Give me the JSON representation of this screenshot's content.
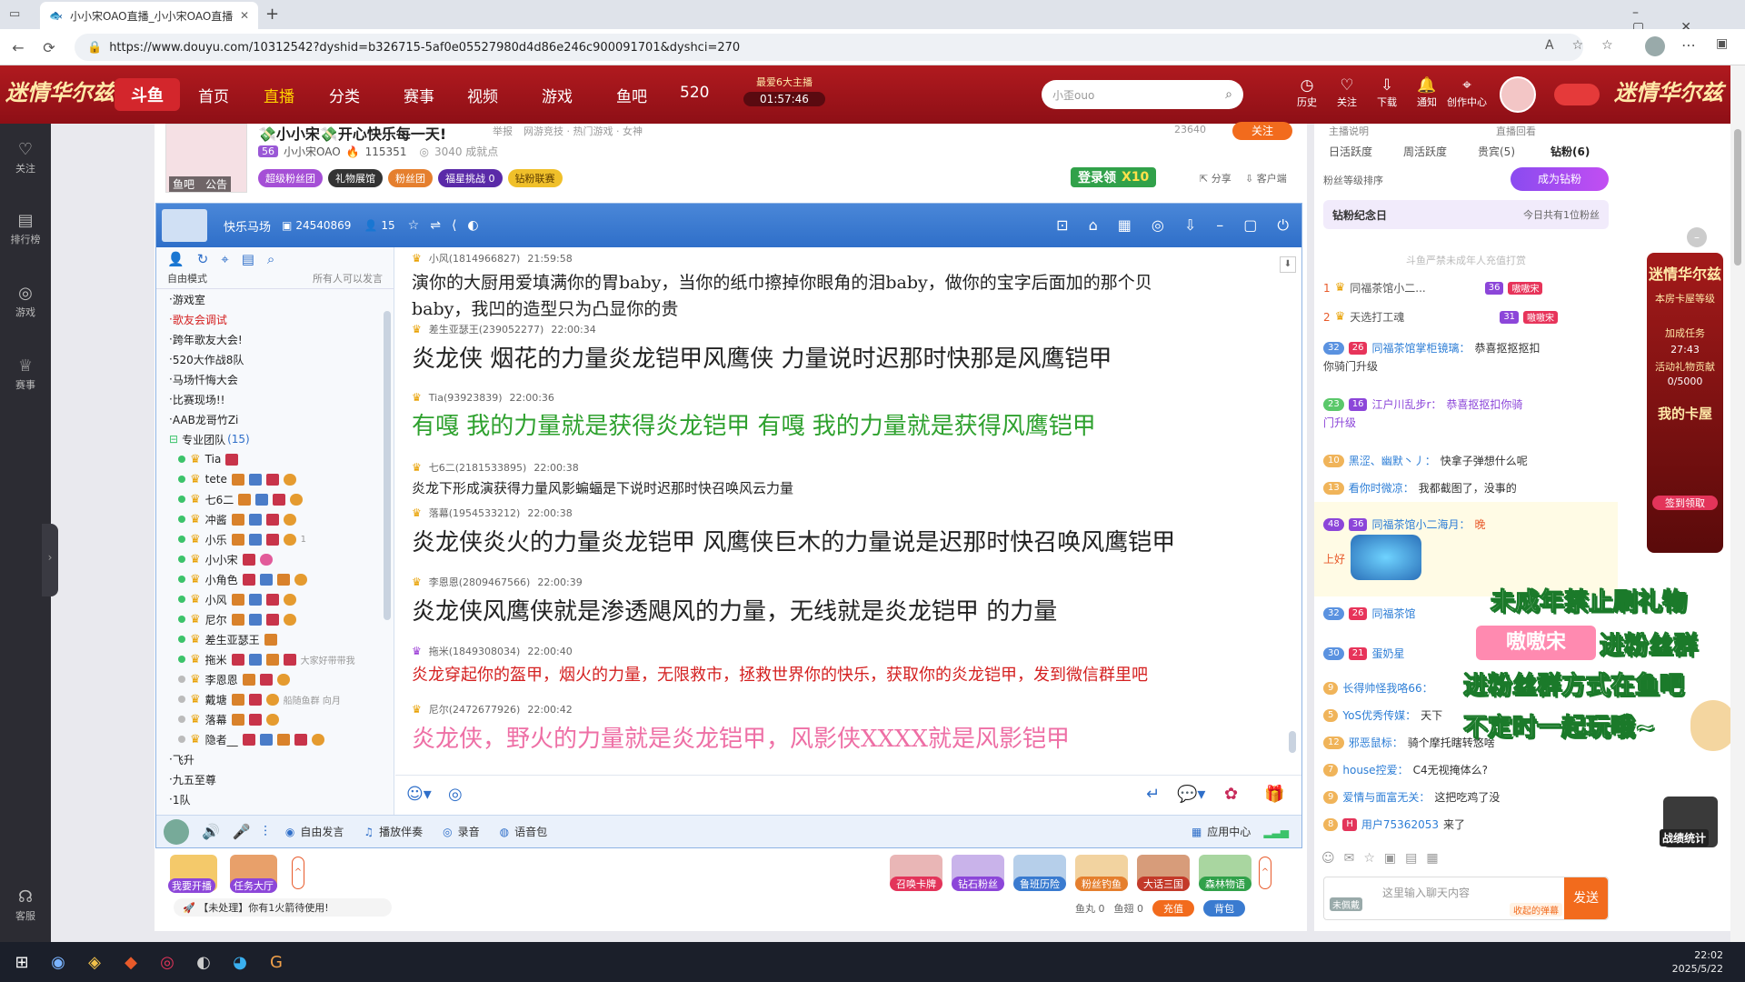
{
  "browser": {
    "tab_title": "小小宋OAO直播_小小宋OAO直播",
    "url": "https://www.douyu.com/10312542?dyshid=b326715-5af0e05527980d4d86e246c900091701&dyshci=270"
  },
  "header": {
    "nav": [
      "首页",
      "直播",
      "分类",
      "赛事",
      "视频",
      "游戏",
      "鱼吧",
      "520"
    ],
    "promo_title": "最爱6大主播",
    "promo_timer": "01:57:46",
    "search_placeholder": "小歪ouo",
    "icons": [
      {
        "label": "历史",
        "icon": "clock-icon"
      },
      {
        "label": "关注",
        "icon": "heart-icon"
      },
      {
        "label": "下载",
        "icon": "download-icon"
      },
      {
        "label": "通知",
        "icon": "bell-icon"
      },
      {
        "label": "创作中心",
        "icon": "pin-icon"
      }
    ],
    "banner_left": "迷情华尔兹",
    "banner_right": "迷情华尔兹"
  },
  "left_sidebar": [
    {
      "label": "关注",
      "icon": "heart-icon"
    },
    {
      "label": "排行榜",
      "icon": "chart-icon"
    },
    {
      "label": "游戏",
      "icon": "gamepad-icon"
    },
    {
      "label": "赛事",
      "icon": "trophy-icon"
    },
    {
      "label": "客服",
      "icon": "headset-icon"
    }
  ],
  "anchor": {
    "title": "💸小小宋💸开心快乐每一天!",
    "report": "举报",
    "category": "网游竞技 · 热门游戏 · 女神",
    "level": "56",
    "name": "小小宋OAO",
    "heat": "115351",
    "achievement": "3040 成就点",
    "follow_count": "23640",
    "follow_btn": "关注",
    "fishbar": "鱼吧",
    "announce": "公告",
    "tags": [
      "超级粉丝团",
      "礼物展馆",
      "粉丝团",
      "福星挑战",
      "钻粉联赛"
    ],
    "fuxing_count": "0",
    "login_reward": "登录领",
    "login_reward_count": "X10",
    "share": "分享",
    "client": "客户端"
  },
  "client": {
    "channel_name": "快乐马场",
    "channel_id": "24540869",
    "online": "15",
    "mode": "自由模式",
    "mode_note": "所有人可以发言",
    "tree_top": [
      "游戏室",
      "歌友会调试",
      "跨年歌友大会!",
      "520大作战8队",
      "马场忏悔大会",
      "比赛现场!!",
      "AAB龙哥竹Zi"
    ],
    "team_label": "专业团队",
    "team_count": "(15)",
    "members": [
      {
        "name": "Tia",
        "online": true
      },
      {
        "name": "tete",
        "online": true
      },
      {
        "name": "七6二",
        "online": true
      },
      {
        "name": "冲酱",
        "online": true
      },
      {
        "name": "小乐",
        "online": true,
        "extra": "1"
      },
      {
        "name": "小小宋",
        "online": true
      },
      {
        "name": "小角色",
        "online": true
      },
      {
        "name": "小风",
        "online": true
      },
      {
        "name": "尼尔",
        "online": true
      },
      {
        "name": "差生亚瑟王",
        "online": true
      },
      {
        "name": "拖米",
        "online": true,
        "extra": "大家好带带我"
      },
      {
        "name": "李恩恩",
        "online": false
      },
      {
        "name": "戴塘",
        "online": false,
        "extra": "船随鱼群 向月"
      },
      {
        "name": "落幕",
        "online": false
      },
      {
        "name": "隐者__",
        "online": false
      }
    ],
    "tree_bottom": [
      "飞升",
      "九五至尊",
      "1队"
    ],
    "messages": [
      {
        "user": "小风(1814966827)",
        "time": "21:59:58",
        "text": "演你的大厨用爱填满你的胃baby，当你的纸巾擦掉你眼角的泪baby，做你的宝字后面加的那个贝",
        "text2": "baby，我凹的造型只为凸显你的贵",
        "color": "#222222"
      },
      {
        "user": "差生亚瑟王(239052277)",
        "time": "22:00:34",
        "text": "炎龙侠  烟花的力量炎龙铠甲风鹰侠  力量说时迟那时快那是风鹰铠甲",
        "color": "#222222"
      },
      {
        "user": "Tia(93923839)",
        "time": "22:00:36",
        "text": "有嘎  我的力量就是获得炎龙铠甲  有嘎  我的力量就是获得风鹰铠甲",
        "color": "#2ea12e"
      },
      {
        "user": "七6二(2181533895)",
        "time": "22:00:38",
        "text": "炎龙下形成演获得力量风影蝙蝠是下说时迟那时快召唤风云力量",
        "color": "#222222"
      },
      {
        "user": "落幕(1954533212)",
        "time": "22:00:38",
        "text": "炎龙侠炎火的力量炎龙铠甲  风鹰侠巨木的力量说是迟那时快召唤风鹰铠甲",
        "color": "#222222"
      },
      {
        "user": "李恩恩(2809467566)",
        "time": "22:00:39",
        "text": "炎龙侠风鹰侠就是渗透飓风的力量，无线就是炎龙铠甲  的力量",
        "color": "#222222"
      },
      {
        "user": "拖米(1849308034)",
        "time": "22:00:40",
        "text": "炎龙穿起你的盔甲，烟火的力量，无限救市，拯救世界你的快乐，获取你的炎龙铠甲，发到微信群里吧",
        "color": "#d42020"
      },
      {
        "user": "尼尔(2472677926)",
        "time": "22:00:42",
        "text": "炎龙侠，野火的力量就是炎龙铠甲，风影侠XXXX就是风影铠甲",
        "color": "#ee6fa5"
      }
    ],
    "bottom": {
      "free_speak": "自由发言",
      "music": "播放伴奏",
      "record": "录音",
      "voice_pack": "语音包",
      "app_center": "应用中心"
    }
  },
  "giftbar": {
    "left": [
      "我要开播",
      "任务大厅"
    ],
    "notice": "【未处理】你有1火箭待使用!",
    "gifts": [
      "召唤卡牌",
      "钻石粉丝",
      "鲁班历险",
      "粉丝钓鱼",
      "大话三国",
      "森林物语"
    ],
    "fish_ball_label": "鱼丸",
    "fish_ball": "0",
    "fish_fin_label": "鱼翅",
    "fish_fin": "0",
    "recharge": "充值",
    "backpack": "背包"
  },
  "right_panel": {
    "top_links": [
      "主播说明",
      "直播回看"
    ],
    "tabs": [
      "日活跃度",
      "周活跃度",
      "贵宾(5)",
      "钻粉(6)"
    ],
    "fan_rank": "粉丝等级排序",
    "become_diamond": "成为钻粉",
    "anniversary": "钻粉纪念日",
    "anniversary_note": "今日共有1位粉丝",
    "minor_notice": "斗鱼严禁未成年人充值打赏",
    "rank": [
      {
        "no": "1",
        "name": "同福茶馆小二...",
        "lv": "36",
        "tag": "嗷嗷宋"
      },
      {
        "no": "2",
        "name": "天选打工魂",
        "lv": "31",
        "tag": "嗷嗷宋"
      }
    ],
    "chat": [
      {
        "lv": "32",
        "fl": "26",
        "name": "同福茶馆掌柜镜璃：",
        "text": "恭喜抠抠抠扣",
        "text2": "你骑门升级"
      },
      {
        "lv": "23",
        "fl": "16",
        "name": "江户川乱步r：",
        "text": "恭喜抠抠扣你骑",
        "text2": "门升级"
      },
      {
        "lv": "10",
        "name": "黑涩、幽默丶丿：",
        "text": "快拿子弹想什么呢"
      },
      {
        "lv": "13",
        "name": "看你时微凉：",
        "text": "我都截图了，没事的"
      },
      {
        "lv": "48",
        "fl": "36",
        "name": "同福茶馆小二海月：",
        "text": "晚",
        "text2": "上好"
      },
      {
        "lv": "32",
        "fl": "26",
        "name": "同福茶馆",
        "text": ""
      },
      {
        "lv": "30",
        "fl": "21",
        "name": "蛋奶星",
        "text": ""
      },
      {
        "lv": "9",
        "name": "长得帅怪我咯66：",
        "text": ""
      },
      {
        "lv": "5",
        "name": "YoS优秀传媒：",
        "text": "天下"
      },
      {
        "lv": "12",
        "name": "邪恶鼠标：",
        "text": "骑个摩托瞎转悠啥"
      },
      {
        "lv": "7",
        "name": "house控爱：",
        "text": "C4无视掩体么?"
      },
      {
        "lv": "9",
        "name": "爱情与面富无关：",
        "text": "这把吃鸡了没"
      },
      {
        "lv": "8",
        "name": "用户75362053",
        "text": "来了"
      }
    ],
    "input_placeholder": "这里输入聊天内容",
    "send": "发送",
    "fold_danmu": "收起的弹幕",
    "not_fan": "未佩戴"
  },
  "overlays": {
    "line1": "未成年禁止刷礼物",
    "line2": "进粉丝群",
    "line3": "进粉丝群方式在鱼吧",
    "line4": "不定时一起玩哦~",
    "badge": "嗷嗷宋",
    "stats": "战绩统计"
  },
  "right_ads": {
    "title": "迷情华尔兹",
    "rank_label": "本房卡屋等级",
    "task": "加成任务",
    "time": "27:43",
    "gift_label": "活动礼物贡献",
    "progress": "0/5000",
    "my_house": "我的卡屋",
    "claim": "签到领取"
  },
  "taskbar": {
    "time": "22:02",
    "date": "2025/5/22"
  },
  "colors": {
    "douyu_red": "#b01a1f",
    "client_blue": "#3a7bd0",
    "green_text": "#2ea12e",
    "red_text": "#d42020",
    "pink_text": "#ee6fa5"
  }
}
